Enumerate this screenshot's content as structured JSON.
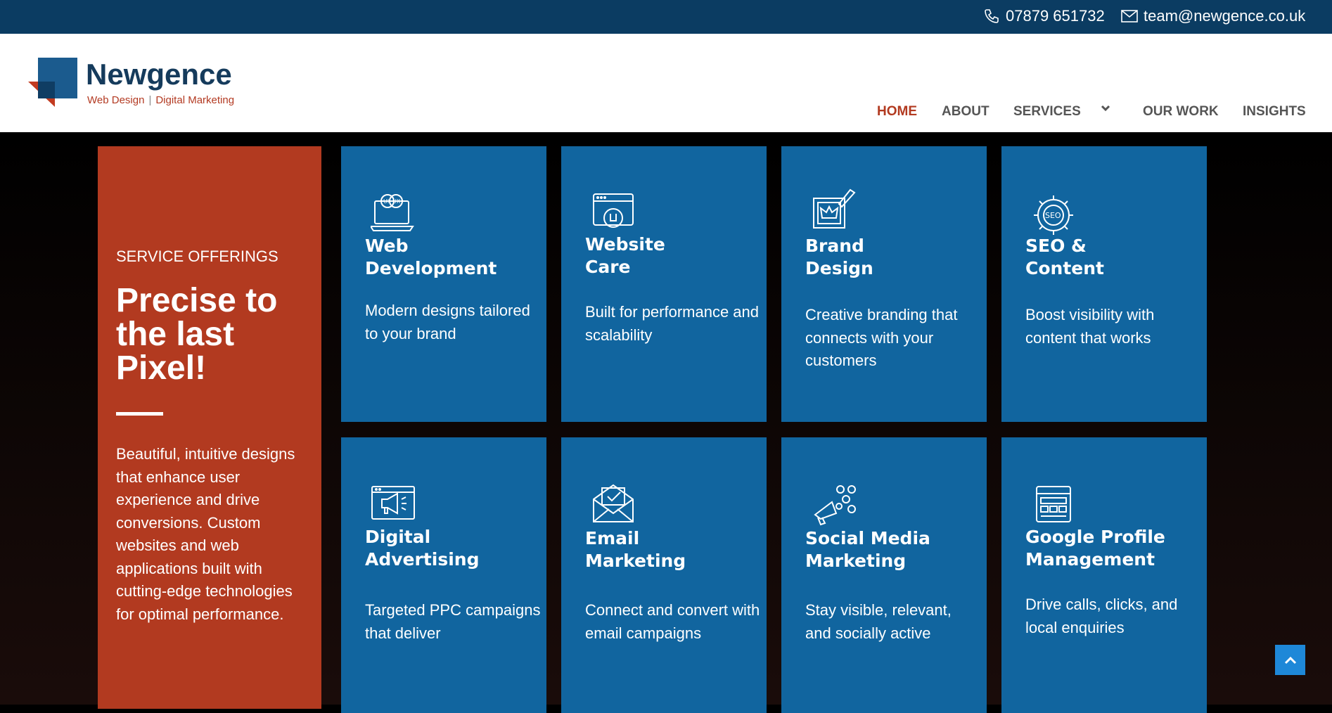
{
  "topbar": {
    "phone": "07879 651732",
    "email": "team@newgence.co.uk"
  },
  "logo": {
    "name": "Newgence",
    "tag_left": "Web Design",
    "tag_sep": "|",
    "tag_right": "Digital Marketing"
  },
  "nav": {
    "home": "HOME",
    "about": "ABOUT",
    "services": "SERVICES",
    "our_work": "OUR WORK",
    "insights": "INSIGHTS"
  },
  "hero": {
    "kicker": "SERVICE OFFERINGS",
    "headline": "Precise to the last Pixel!",
    "description": "Beautiful, intuitive designs that enhance user experience and drive conversions. Custom websites and web applications built with cutting-edge technologies for optimal performance."
  },
  "services": [
    {
      "title_1": "Web",
      "title_2": "Development",
      "desc": "Modern designs tailored to your brand",
      "icon": "ui-ux-laptop-icon"
    },
    {
      "title_1": "Website",
      "title_2": "Care",
      "desc": "Built for performance and scalability",
      "icon": "browser-wrench-icon"
    },
    {
      "title_1": "Brand",
      "title_2": "Design",
      "desc": "Creative branding that connects with your customers",
      "icon": "brand-pen-icon"
    },
    {
      "title_1": "SEO &",
      "title_2": "Content",
      "desc": "Boost visibility with content that works",
      "icon": "seo-gear-icon"
    },
    {
      "title_1": "Digital",
      "title_2": "Advertising",
      "desc": "Targeted PPC campaigns that deliver",
      "icon": "megaphone-browser-icon"
    },
    {
      "title_1": "Email",
      "title_2": "Marketing",
      "desc": "Connect and convert with email campaigns",
      "icon": "email-envelope-icon"
    },
    {
      "title_1": "Social Media",
      "title_2": "Marketing",
      "desc": "Stay visible, relevant, and socially active",
      "icon": "social-megaphone-icon"
    },
    {
      "title_1": "Google Profile",
      "title_2": "Management",
      "desc": "Drive calls, clicks, and local enquiries",
      "icon": "profile-layout-icon"
    }
  ],
  "colors": {
    "topbar": "#0b3c62",
    "accent_red": "#b23a20",
    "card_blue": "#11659f",
    "nav_gray": "#555555"
  }
}
